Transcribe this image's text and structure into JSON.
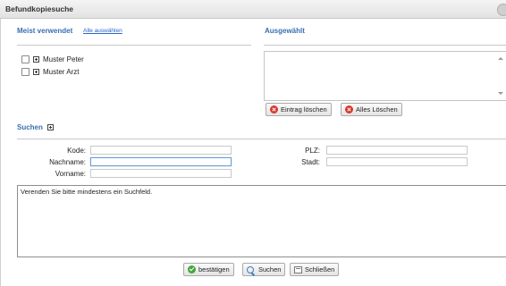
{
  "window": {
    "title": "Befundkopiesuche"
  },
  "meist": {
    "heading": "Meist verwendet",
    "select_all_link": "Alle auswählen",
    "items": [
      {
        "label": "Muster Peter"
      },
      {
        "label": "Muster Arzt"
      }
    ]
  },
  "ausgewaehlt": {
    "heading": "Ausgewählt",
    "delete_entry_label": "Eintrag löschen",
    "delete_all_label": "Alles Löschen"
  },
  "suchen": {
    "heading": "Suchen",
    "fields": {
      "kode": {
        "label": "Kode:",
        "value": ""
      },
      "nachname": {
        "label": "Nachname:",
        "value": ""
      },
      "vorname": {
        "label": "Vorname:",
        "value": ""
      },
      "plz": {
        "label": "PLZ:",
        "value": ""
      },
      "stadt": {
        "label": "Stadt:",
        "value": ""
      }
    }
  },
  "message": "Verenden Sie bitte mindestens ein Suchfeld.",
  "footer": {
    "confirm_label": "bestätigen",
    "search_label": "Suchen",
    "close_label": "Schließen"
  }
}
